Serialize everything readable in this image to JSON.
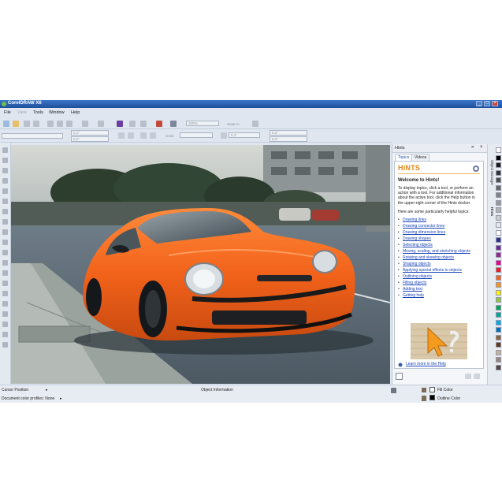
{
  "window": {
    "title": "CorelDRAW X6"
  },
  "menu": [
    {
      "label": "File",
      "enabled": true
    },
    {
      "label": "View",
      "enabled": false
    },
    {
      "label": "Tools",
      "enabled": true
    },
    {
      "label": "Window",
      "enabled": true
    },
    {
      "label": "Help",
      "enabled": true
    }
  ],
  "toolbar": {
    "zoom_value": "100%",
    "snap_label": "Snap to"
  },
  "propbar": {
    "width_value": "0.1\"",
    "height_value": "0.1\"",
    "units_label": "Units:",
    "nudge_value": "0.1\"",
    "dup_x": "0.2\"",
    "dup_y": "0.2\""
  },
  "docker": {
    "title": "Hints",
    "tabs": [
      "Topics",
      "Videos"
    ],
    "heading": "HINTS",
    "welcome": "Welcome to Hints!",
    "intro": "To display topics, click a tool, or perform an action with a tool. For additional information about the active tool, click the Help button in the upper-right corner of the Hints docker.",
    "sub": "Here are some particularly helpful topics:",
    "links": [
      "Drawing lines",
      "Drawing connector lines",
      "Drawing dimension lines",
      "Drawing shapes",
      "Selecting objects",
      "Moving, scaling, and stretching objects",
      "Rotating and skewing objects",
      "Shaping objects",
      "Applying special effects to objects",
      "Outlining objects",
      "Filling objects",
      "Adding text",
      "Getting help"
    ],
    "learn_more": "Learn more in the Help"
  },
  "side_tabs": [
    "Object Manager",
    "Hints"
  ],
  "palette": [
    "#ffffff",
    "#000000",
    "#1a1a1a",
    "#333333",
    "#4d4d4d",
    "#666666",
    "#808080",
    "#999999",
    "#b3b3b3",
    "#cccccc",
    "#e6e6e6",
    "#ffffff",
    "#2e3192",
    "#662d91",
    "#92278f",
    "#ec008c",
    "#ed1c24",
    "#f26522",
    "#f7941d",
    "#fff200",
    "#8dc63f",
    "#00a651",
    "#00a99d",
    "#00aeef",
    "#0072bc",
    "#8c6239",
    "#603913",
    "#c7b299",
    "#998675",
    "#534741"
  ],
  "status": {
    "cursor_label": "Cursor Position",
    "object_info": "Object Information",
    "color_profile": "Document color profiles: None",
    "fill_label": "Fill Color",
    "outline_label": "Outline Color"
  },
  "colors": {
    "accent": "#1e4f9c",
    "hints_orange": "#e08a1a",
    "car_orange": "#ff6a1a",
    "link": "#1a44b8"
  }
}
